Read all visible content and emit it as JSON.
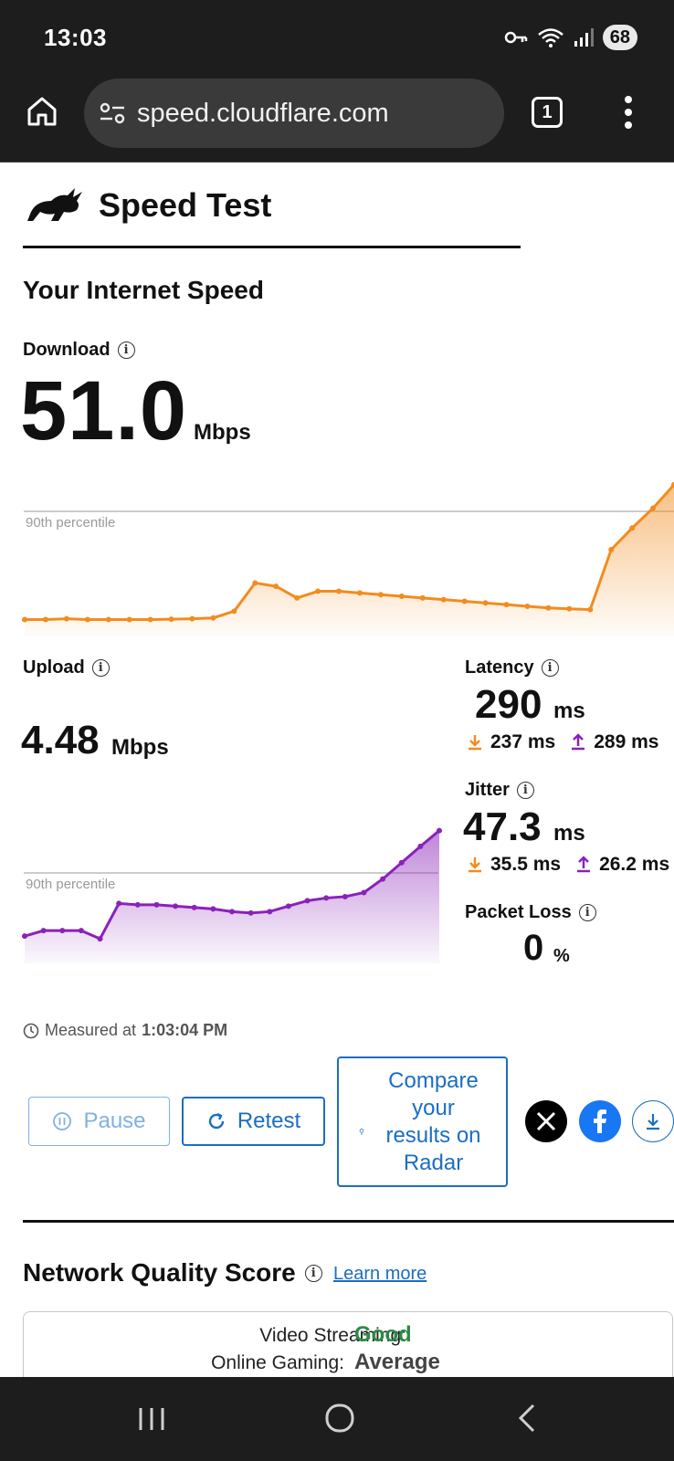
{
  "status_bar": {
    "time": "13:03",
    "battery": "68",
    "icons": [
      "key-icon",
      "wifi-icon",
      "signal-icon"
    ]
  },
  "browser": {
    "url": "speed.cloudflare.com",
    "tab_count": "1"
  },
  "header": {
    "title": "Speed Test",
    "logo": "rabbit-logo-icon"
  },
  "section_title": "Your Internet Speed",
  "download": {
    "label": "Download",
    "value": "51.0",
    "unit": "Mbps",
    "percentile_label": "90th percentile"
  },
  "upload": {
    "label": "Upload",
    "value": "4.48",
    "unit": "Mbps",
    "percentile_label": "90th percentile"
  },
  "latency": {
    "label": "Latency",
    "value": "290",
    "unit": "ms",
    "down": "237 ms",
    "up": "289 ms"
  },
  "jitter": {
    "label": "Jitter",
    "value": "47.3",
    "unit": "ms",
    "down": "35.5 ms",
    "up": "26.2 ms"
  },
  "packet_loss": {
    "label": "Packet Loss",
    "value": "0",
    "unit": "%"
  },
  "measured": {
    "prefix": "Measured at",
    "time": "1:03:04 PM"
  },
  "buttons": {
    "pause": "Pause",
    "retest": "Retest",
    "radar": "Compare your results on Radar"
  },
  "network_quality": {
    "title": "Network Quality Score",
    "learn_more": "Learn more",
    "rows": [
      {
        "label": "Video Streaming:",
        "value": "Good",
        "color": "#2e8b45"
      },
      {
        "label": "Online Gaming:",
        "value": "Average",
        "color": "#444444"
      }
    ]
  },
  "colors": {
    "download": "#f28c1e",
    "upload": "#8a22b8",
    "link": "#1b6ec2"
  },
  "chart_data": [
    {
      "type": "area",
      "series": [
        {
          "values": [
            3,
            3,
            3.5,
            3,
            3,
            3,
            3,
            3.2,
            3.5,
            4,
            8,
            25,
            23,
            16,
            20,
            20,
            19,
            18,
            17,
            16,
            15,
            14,
            13,
            12,
            11,
            10,
            9.5,
            9,
            45,
            58,
            70,
            84
          ]
        }
      ],
      "xlabel": "",
      "ylabel": "",
      "annotations": [
        "90th percentile"
      ],
      "grid": false
    },
    {
      "type": "area",
      "series": [
        {
          "values": [
            0.6,
            0.8,
            0.8,
            0.8,
            0.5,
            1.8,
            1.75,
            1.75,
            1.7,
            1.65,
            1.6,
            1.5,
            1.45,
            1.5,
            1.7,
            1.9,
            2.0,
            2.05,
            2.2,
            2.7,
            3.3,
            3.9,
            4.48
          ]
        }
      ],
      "xlabel": "",
      "ylabel": "",
      "annotations": [
        "90th percentile"
      ],
      "grid": false
    }
  ]
}
